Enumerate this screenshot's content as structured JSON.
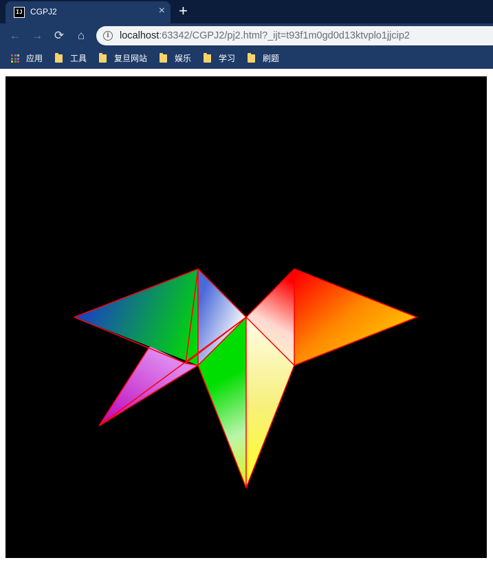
{
  "tab": {
    "title": "CGPJ2",
    "favicon_text": "IJ",
    "close_icon": "×"
  },
  "new_tab_icon": "+",
  "nav": {
    "back": "←",
    "forward": "→",
    "reload": "⟳",
    "home": "⌂"
  },
  "address": {
    "host": "localhost",
    "rest": ":63342/CGPJ2/pj2.html?_ijt=t93f1m0gd0d13ktvplo1jjcip2",
    "info_icon": "i"
  },
  "bookmarks": {
    "apps_label": "应用",
    "apps_colors": [
      "#ea4335",
      "#4285f4",
      "#fbbc05",
      "#34a853",
      "#ea4335",
      "#4285f4",
      "#fbbc05",
      "#34a853",
      "#ea4335"
    ],
    "folders": [
      "工具",
      "复旦网站",
      "娱乐",
      "学习",
      "刷题"
    ]
  },
  "scene": {
    "background": "#000000",
    "edge_color": "#ff0000",
    "colors": {
      "red": "#ff0000",
      "blue": "#1a3cc8",
      "green": "#00dd00",
      "yellow": "#ffff22",
      "purple": "#bb00bb",
      "orange": "#ff8800",
      "white": "#ffffff"
    }
  }
}
